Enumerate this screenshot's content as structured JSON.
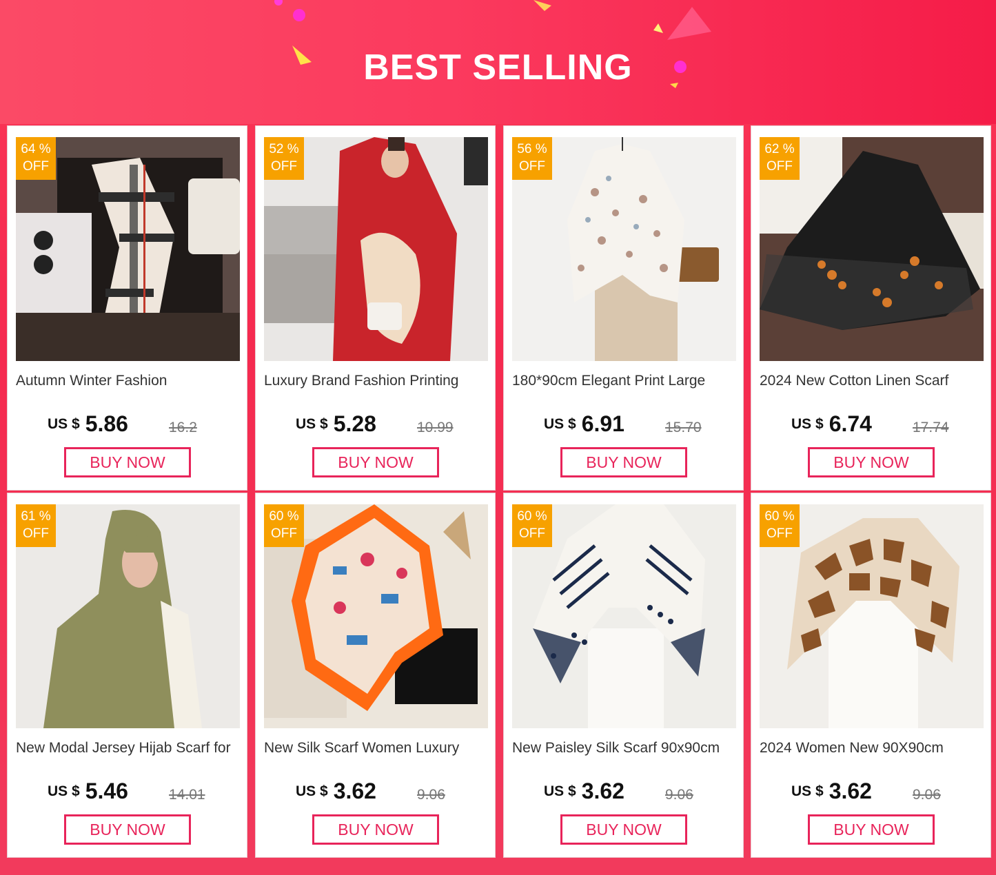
{
  "header": {
    "title": "BEST SELLING"
  },
  "colors": {
    "accent": "#e8245a",
    "badge": "#f7a100",
    "background": "#fb3a5e"
  },
  "products": [
    {
      "discount": "64 %",
      "off": "OFF",
      "name": "Autumn Winter Fashion",
      "currency": "US $",
      "price": "5.86",
      "old_price": "16.2",
      "button": "BUY NOW",
      "image": "plaid-cashmere-scarf"
    },
    {
      "discount": "52 %",
      "off": "OFF",
      "name": "Luxury Brand Fashion Printing",
      "currency": "US $",
      "price": "5.28",
      "old_price": "10.99",
      "button": "BUY NOW",
      "image": "red-printed-shawl"
    },
    {
      "discount": "56 %",
      "off": "OFF",
      "name": "180*90cm Elegant Print Large",
      "currency": "US $",
      "price": "6.91",
      "old_price": "15.70",
      "button": "BUY NOW",
      "image": "floral-print-scarf"
    },
    {
      "discount": "62 %",
      "off": "OFF",
      "name": "2024 New Cotton Linen Scarf",
      "currency": "US $",
      "price": "6.74",
      "old_price": "17.74",
      "button": "BUY NOW",
      "image": "black-embroidered-scarf"
    },
    {
      "discount": "61 %",
      "off": "OFF",
      "name": "New Modal Jersey Hijab Scarf for",
      "currency": "US $",
      "price": "5.46",
      "old_price": "14.01",
      "button": "BUY NOW",
      "image": "olive-hijab"
    },
    {
      "discount": "60 %",
      "off": "OFF",
      "name": "New Silk Scarf Women Luxury",
      "currency": "US $",
      "price": "3.62",
      "old_price": "9.06",
      "button": "BUY NOW",
      "image": "orange-silk-scarf"
    },
    {
      "discount": "60 %",
      "off": "OFF",
      "name": "New Paisley Silk Scarf 90x90cm",
      "currency": "US $",
      "price": "3.62",
      "old_price": "9.06",
      "button": "BUY NOW",
      "image": "navy-pattern-scarf"
    },
    {
      "discount": "60 %",
      "off": "OFF",
      "name": "2024 Women New 90X90cm",
      "currency": "US $",
      "price": "3.62",
      "old_price": "9.06",
      "button": "BUY NOW",
      "image": "giraffe-print-scarf"
    }
  ]
}
